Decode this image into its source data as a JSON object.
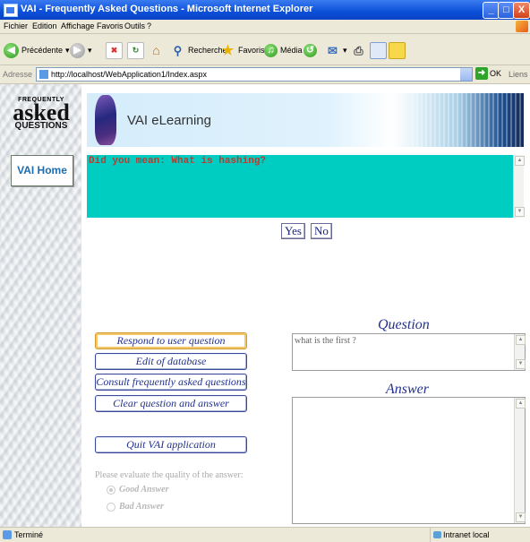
{
  "window": {
    "title": "VAI - Frequently Asked Questions - Microsoft Internet Explorer",
    "controls": [
      "_",
      "□",
      "X"
    ]
  },
  "menu": [
    "Fichier",
    "Edition",
    "Affichage",
    "Favoris",
    "Outils",
    "?"
  ],
  "toolbar": {
    "back": "Précédente",
    "search": "Rechercher",
    "favorites": "Favoris",
    "media": "Média"
  },
  "address": {
    "label": "Adresse",
    "url": "http://localhost/WebApplication1/Index.aspx",
    "go": "OK",
    "links": "Liens"
  },
  "sidebar": {
    "logo_line1": "FREQUENTLY",
    "logo_line2": "asked",
    "logo_line3": "QUESTIONS",
    "home": "VAI Home"
  },
  "banner": {
    "text": "VAI eLearning"
  },
  "suggestion": {
    "text": "Did you mean: What is hashing?"
  },
  "confirm": {
    "yes": "Yes",
    "no": "No"
  },
  "question": {
    "heading": "Question",
    "value": "what is the first ?"
  },
  "answer": {
    "heading": "Answer",
    "value": ""
  },
  "actions": {
    "respond": "Respond to user question",
    "edit": "Edit of database",
    "consult": "Consult frequently asked questions",
    "clear": "Clear question and answer",
    "quit": "Quit VAI application"
  },
  "evaluation": {
    "prompt": "Please evaluate the quality of the answer:",
    "good": "Good Answer",
    "bad": "Bad Answer",
    "selected": "good"
  },
  "status": {
    "left": "Terminé",
    "zone": "Intranet local"
  }
}
